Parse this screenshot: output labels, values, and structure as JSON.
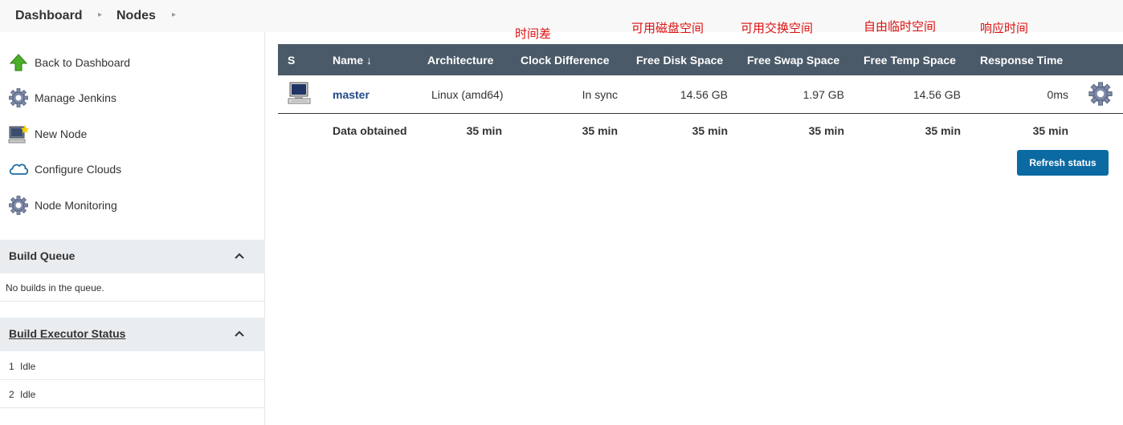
{
  "breadcrumb": {
    "items": [
      "Dashboard",
      "Nodes"
    ]
  },
  "sidebar": {
    "tasks": [
      {
        "label": "Back to Dashboard",
        "icon": "up-arrow-icon"
      },
      {
        "label": "Manage Jenkins",
        "icon": "gear-icon"
      },
      {
        "label": "New Node",
        "icon": "computer-new-icon"
      },
      {
        "label": "Configure Clouds",
        "icon": "cloud-icon"
      },
      {
        "label": "Node Monitoring",
        "icon": "gear-icon"
      }
    ],
    "build_queue": {
      "title": "Build Queue",
      "empty_text": "No builds in the queue."
    },
    "executor_status": {
      "title": "Build Executor Status",
      "executors": [
        {
          "number": "1",
          "status": "Idle"
        },
        {
          "number": "2",
          "status": "Idle"
        }
      ]
    }
  },
  "table": {
    "headers": [
      "S",
      "Name ↓",
      "Architecture",
      "Clock Difference",
      "Free Disk Space",
      "Free Swap Space",
      "Free Temp Space",
      "Response Time"
    ],
    "rows": [
      {
        "name": "master",
        "architecture": "Linux (amd64)",
        "clock": "In sync",
        "disk": "14.56 GB",
        "swap": "1.97 GB",
        "temp": "14.56 GB",
        "response": "0ms"
      }
    ],
    "obtained": {
      "label": "Data obtained",
      "clock": "35 min",
      "arch": "35 min",
      "disk": "35 min",
      "swap": "35 min",
      "temp": "35 min",
      "response": "35 min"
    }
  },
  "refresh_label": "Refresh status",
  "annotations": [
    "时间差",
    "可用磁盘空间",
    "可用交换空间",
    "自由临时空间",
    "响应时间"
  ],
  "colors": {
    "header_bg": "#4b5a69",
    "button_bg": "#0b6aa2",
    "annotation": "#dd1111",
    "link": "#204a87"
  }
}
